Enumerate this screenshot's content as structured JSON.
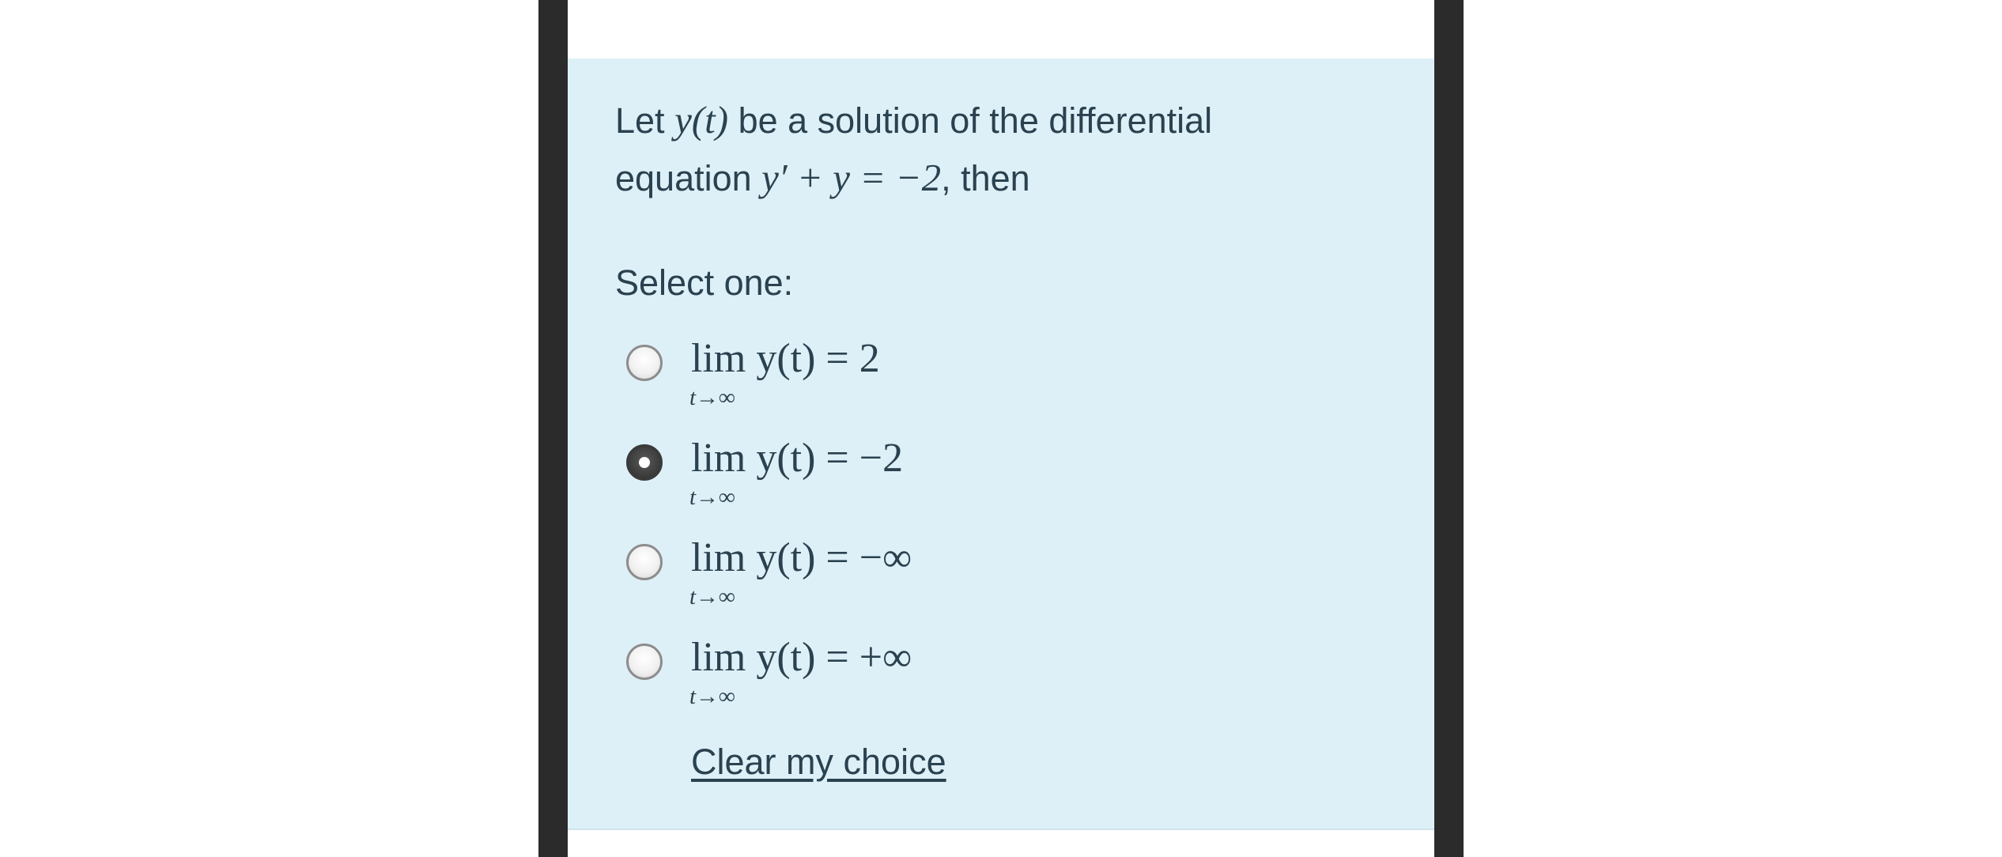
{
  "question": {
    "line1_pre": "Let ",
    "line1_math": "y(t)",
    "line1_post": " be a solution of the differential",
    "line2_pre": "equation ",
    "line2_math": "y′ + y = −2",
    "line2_post": ", then"
  },
  "select_label": "Select one:",
  "options": [
    {
      "lhs": "lim y(t)",
      "rhs": "= 2",
      "sub": "t→∞",
      "checked": false
    },
    {
      "lhs": "lim y(t)",
      "rhs": "= −2",
      "sub": "t→∞",
      "checked": true
    },
    {
      "lhs": "lim y(t)",
      "rhs": "= −∞",
      "sub": "t→∞",
      "checked": false
    },
    {
      "lhs": "lim y(t)",
      "rhs": "= +∞",
      "sub": "t→∞",
      "checked": false
    }
  ],
  "clear_label": "Clear my choice",
  "colors": {
    "card_background": "#def0f7",
    "text": "#2a4250",
    "bezel": "#2b2b2b"
  }
}
